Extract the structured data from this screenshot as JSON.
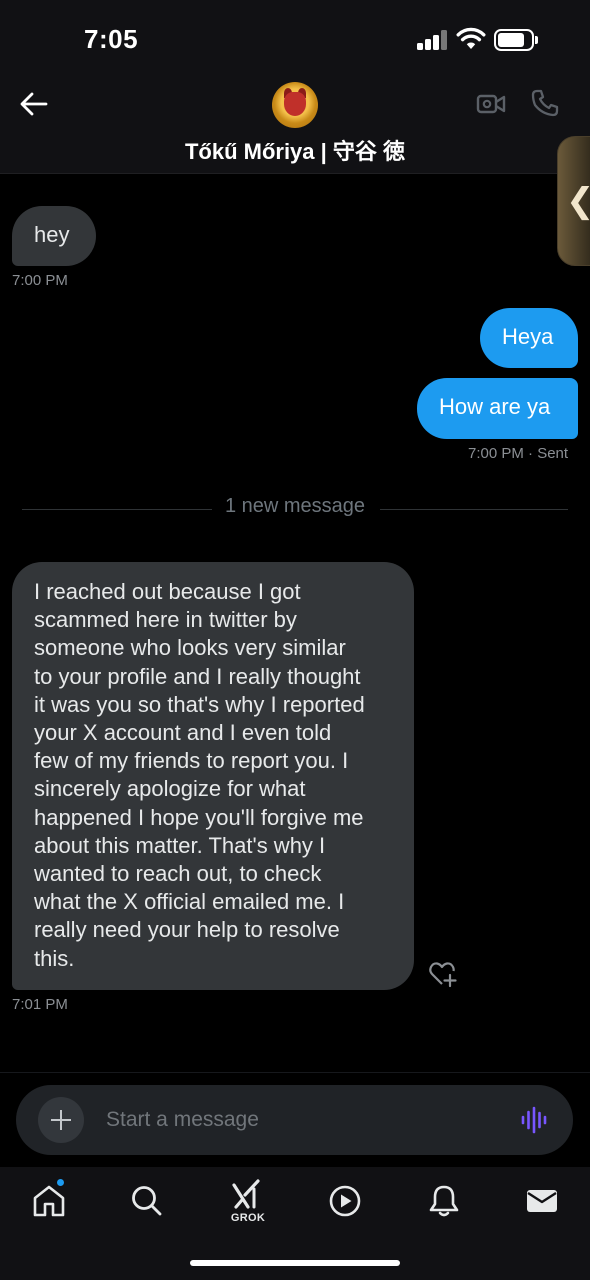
{
  "status_bar": {
    "time": "7:05"
  },
  "header": {
    "title": "Tőkű Mőriya | 守谷 徳"
  },
  "messages": [
    {
      "direction": "incoming",
      "text": "hey"
    },
    {
      "direction": "incoming_timestamp",
      "text": "7:00 PM"
    },
    {
      "direction": "outgoing",
      "text": "Heya"
    },
    {
      "direction": "outgoing",
      "text": "How are ya"
    },
    {
      "direction": "outgoing_timestamp",
      "text": "7:00 PM",
      "status": "· Sent"
    },
    {
      "direction": "incoming",
      "lines": [
        "I reached out because I got",
        "scammed here in twitter by",
        "someone who looks very similar",
        "to your profile and I really thought",
        "it was you so that's why I reported",
        "your X account and I even told",
        "few of my friends to report you. I",
        "sincerely apologize for what",
        "happened I hope you'll forgive me",
        "about this matter. That's why I",
        "wanted to reach out, to check",
        "what the X official emailed me. I",
        "really need your help to resolve",
        "this."
      ]
    },
    {
      "direction": "incoming_timestamp",
      "text": "7:01 PM"
    }
  ],
  "divider": {
    "text": "1 new message"
  },
  "composer": {
    "placeholder": "Start a message"
  },
  "tabs": {
    "grok_label": "GROK"
  },
  "colors": {
    "accent": "#1d9bf0",
    "incoming_bubble": "#333639",
    "voice": "#7856ff"
  },
  "icons": [
    "back-arrow-icon",
    "video-icon",
    "phone-icon",
    "heart-plus-icon",
    "plus-icon",
    "voice-wave-icon",
    "home-icon",
    "search-icon",
    "grok-icon",
    "play-icon",
    "bell-icon",
    "mail-icon"
  ]
}
